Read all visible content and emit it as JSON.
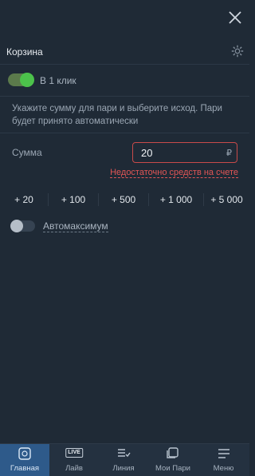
{
  "header": {
    "title": "Корзина"
  },
  "one_click": {
    "label": "В 1 клик",
    "enabled": true
  },
  "hint": "Укажите сумму для пари и выберите исход. Пари будет принято автоматически",
  "amount": {
    "label": "Сумма",
    "value": "20",
    "currency": "₽",
    "error": "Недостаточно средств на счете"
  },
  "quick_amounts": [
    "+ 20",
    "+ 100",
    "+ 500",
    "+ 1 000",
    "+ 5 000"
  ],
  "auto_max": {
    "label": "Автомаксимум",
    "enabled": false
  },
  "nav": [
    {
      "label": "Главная",
      "icon": "home-ball-icon",
      "active": true
    },
    {
      "label": "Лайв",
      "icon": "live-icon",
      "badge": "LIVE"
    },
    {
      "label": "Линия",
      "icon": "line-list-icon"
    },
    {
      "label": "Мои Пари",
      "icon": "my-bets-icon"
    },
    {
      "label": "Меню",
      "icon": "menu-icon"
    }
  ],
  "colors": {
    "background": "#1f2a36",
    "toggle_on": "#4cc24b",
    "error": "#e05555",
    "active_nav": "#2e5a8a"
  }
}
